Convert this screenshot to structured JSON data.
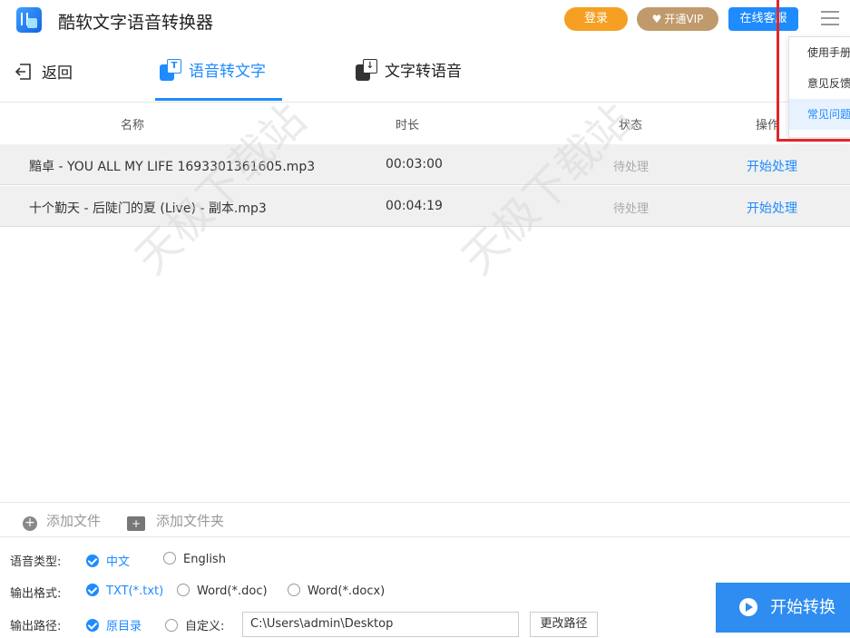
{
  "app": {
    "title": "酷软文字语音转换器"
  },
  "header": {
    "login_label": "登录",
    "vip_label": "开通VIP",
    "service_label": "在线客服"
  },
  "menu": {
    "items": [
      {
        "label": "使用手册"
      },
      {
        "label": "意见反馈"
      },
      {
        "label": "常见问题"
      }
    ],
    "active_index": 2
  },
  "nav": {
    "back_label": "返回",
    "tabs": [
      {
        "label": "语音转文字",
        "active": true
      },
      {
        "label": "文字转语音",
        "active": false
      }
    ]
  },
  "table": {
    "headers": {
      "name": "名称",
      "duration": "时长",
      "status": "状态",
      "action": "操作"
    },
    "rows": [
      {
        "name": "黯卓 - YOU ALL MY LIFE 1693301361605.mp3",
        "duration": "00:03:00",
        "status": "待处理",
        "action": "开始处理"
      },
      {
        "name": "十个勤天 - 后陡门的夏 (Live) - 副本.mp3",
        "duration": "00:04:19",
        "status": "待处理",
        "action": "开始处理"
      }
    ]
  },
  "toolbar": {
    "add_file_label": "添加文件",
    "add_folder_label": "添加文件夹"
  },
  "options": {
    "voice_type": {
      "label": "语音类型:",
      "choices": [
        "中文",
        "English"
      ],
      "selected": "中文"
    },
    "output_format": {
      "label": "输出格式:",
      "choices": [
        "TXT(*.txt)",
        "Word(*.doc)",
        "Word(*.docx)"
      ],
      "selected": "TXT(*.txt)"
    },
    "output_path": {
      "label": "输出路径:",
      "choices": [
        "原目录",
        "自定义:"
      ],
      "selected": "原目录",
      "path_value": "C:\\Users\\admin\\Desktop",
      "change_label": "更改路径"
    }
  },
  "start_button": {
    "label": "开始转换"
  },
  "watermark": "天极下载站",
  "colors": {
    "accent": "#1e8bff",
    "login": "#f5a023",
    "vip": "#c19a6b",
    "highlight_frame": "#e0262a"
  }
}
